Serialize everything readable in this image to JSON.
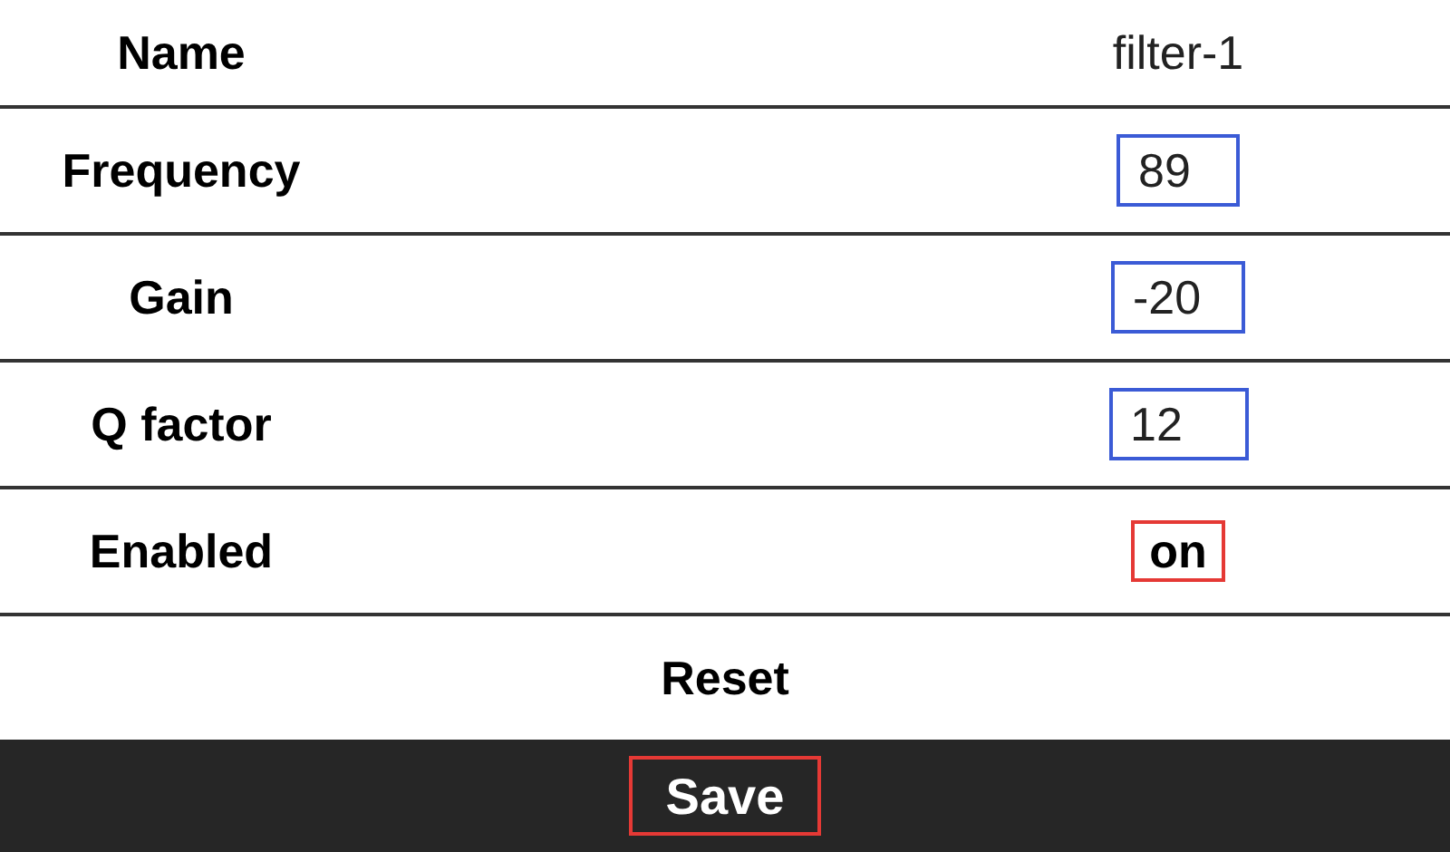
{
  "rows": [
    {
      "kind": "text",
      "label": "Name",
      "value": "filter-1"
    },
    {
      "kind": "input",
      "label": "Frequency",
      "value": "89"
    },
    {
      "kind": "input",
      "label": "Gain",
      "value": "-20"
    },
    {
      "kind": "input",
      "label": "Q factor",
      "value": "12"
    },
    {
      "kind": "toggle",
      "label": "Enabled",
      "value": "on"
    }
  ],
  "reset_button": "Reset",
  "save_button": "Save"
}
